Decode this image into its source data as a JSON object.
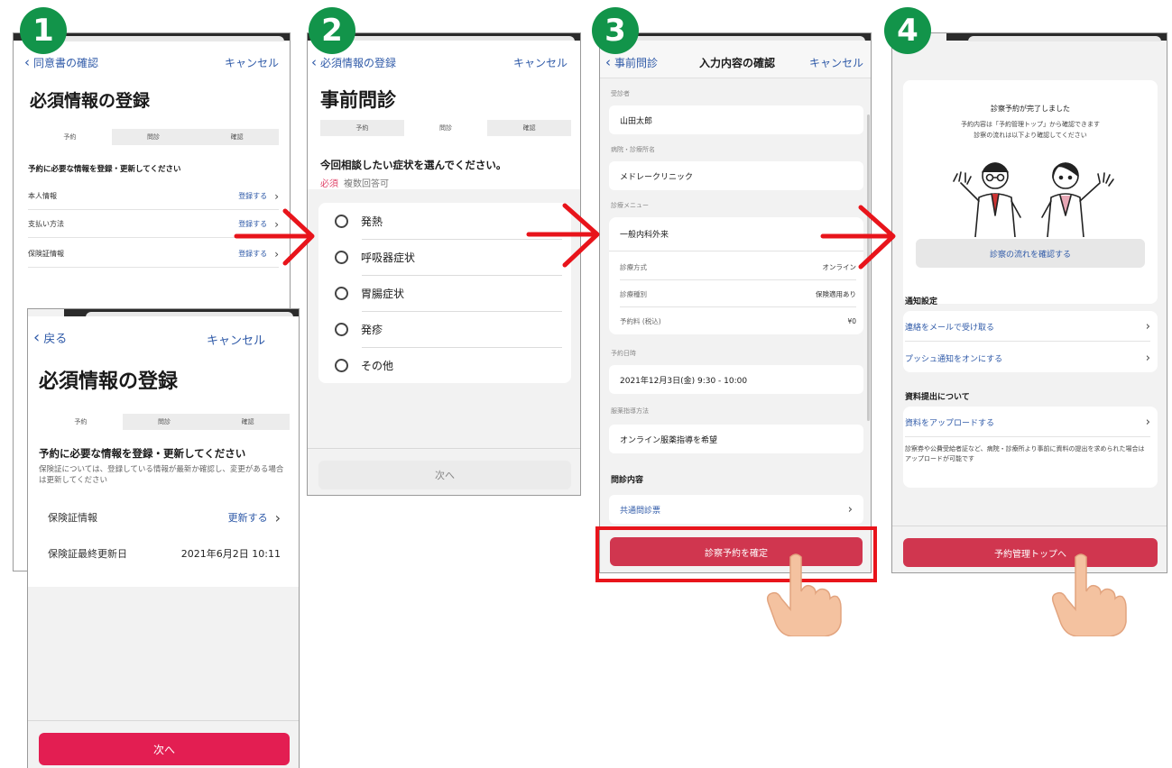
{
  "colors": {
    "link": "#2f5aa8",
    "badge": "#12944a",
    "arrow": "#e8141b",
    "confirm_button": "#d0364f",
    "next_button": "#e31e52",
    "required": "#e0456a",
    "highlight_box": "#e8141b"
  },
  "badges": [
    "1",
    "2",
    "3",
    "4"
  ],
  "screen1": {
    "back": "同意書の確認",
    "cancel": "キャンセル",
    "title": "必須情報の登録",
    "steps": [
      "予約",
      "問診",
      "確認"
    ],
    "section": "予約に必要な情報を登録・更新してください",
    "rows": [
      {
        "label": "本人情報",
        "action": "登録する"
      },
      {
        "label": "支払い方法",
        "action": "登録する"
      },
      {
        "label": "保険証情報",
        "action": "登録する"
      }
    ]
  },
  "screen1b": {
    "back": "戻る",
    "cancel": "キャンセル",
    "title": "必須情報の登録",
    "steps": [
      "予約",
      "問診",
      "確認"
    ],
    "section": "予約に必要な情報を登録・更新してください",
    "note": "保険証については、登録している情報が最新か確認し、変更がある場合は更新してください",
    "row1": {
      "label": "保険証情報",
      "action": "更新する"
    },
    "row2": {
      "label": "保険証最終更新日",
      "value": "2021年6月2日 10:11"
    },
    "next": "次へ"
  },
  "screen2": {
    "back": "必須情報の登録",
    "cancel": "キャンセル",
    "title": "事前問診",
    "steps": [
      "予約",
      "問診",
      "確認"
    ],
    "question": "今回相談したい症状を選んでください。",
    "required": "必須",
    "multi": "複数回答可",
    "options": [
      "発熱",
      "呼吸器症状",
      "胃腸症状",
      "発疹",
      "その他"
    ],
    "next": "次へ"
  },
  "screen3": {
    "back": "事前問診",
    "title": "入力内容の確認",
    "cancel": "キャンセル",
    "patient_label": "受診者",
    "patient": "山田太郎",
    "clinic_label": "病院・診療所名",
    "clinic": "メドレークリニック",
    "menu_label": "診療メニュー",
    "menu": "一般内科外来",
    "details": [
      {
        "label": "診療方式",
        "value": "オンライン"
      },
      {
        "label": "診療種別",
        "value": "保険適用あり"
      },
      {
        "label": "予約料 (税込)",
        "value": "¥0"
      }
    ],
    "date_label": "予約日時",
    "date": "2021年12月3日(金) 9:30 - 10:00",
    "guidance_label": "服薬指導方法",
    "guidance": "オンライン服薬指導を希望",
    "interview_heading": "問診内容",
    "interview_link": "共通問診票",
    "confirm": "診察予約を確定"
  },
  "screen4": {
    "done": "診察予約が完了しました",
    "desc1": "予約内容は「予約管理トップ」から確認できます",
    "desc2": "診察の流れは以下より確認してください",
    "flow_button": "診察の流れを確認する",
    "notify_heading": "通知設定",
    "notify_items": [
      "連絡をメールで受け取る",
      "プッシュ通知をオンにする"
    ],
    "docs_heading": "資料提出について",
    "docs_link": "資料をアップロードする",
    "docs_note": "診察券や公費受給者証など、病院・診療所より事前に資料の提出を求められた場合はアップロードが可能です",
    "top_button": "予約管理トップへ"
  }
}
